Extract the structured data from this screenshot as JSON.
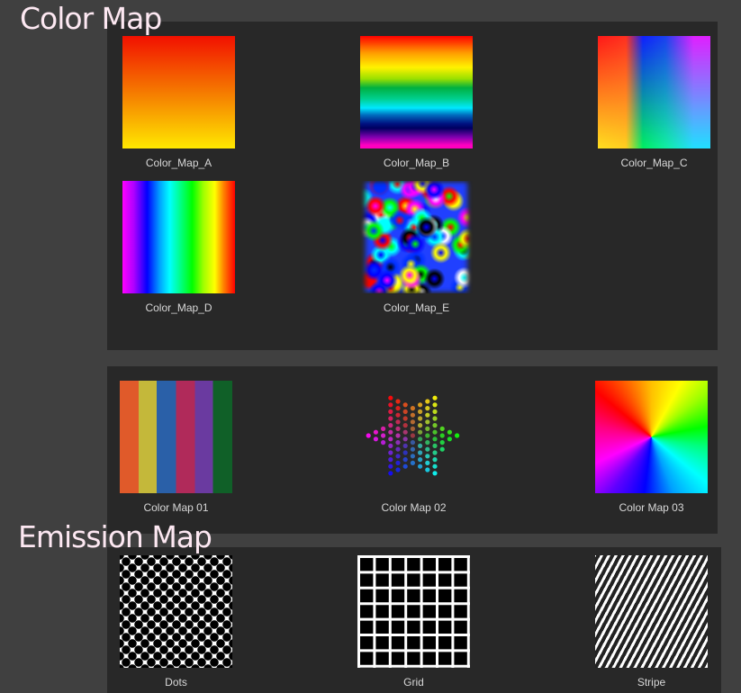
{
  "sections": [
    {
      "title": "Color Map"
    },
    {
      "title": "Emission Map"
    }
  ],
  "color_map_panel_1": {
    "items": [
      {
        "label": "Color_Map_A",
        "icon": "vertical-red-yellow-gradient"
      },
      {
        "label": "Color_Map_B",
        "icon": "horizontal-rainbow-bands"
      },
      {
        "label": "Color_Map_C",
        "icon": "2d-hue-gradient"
      },
      {
        "label": "Color_Map_D",
        "icon": "vertical-rainbow-bands"
      },
      {
        "label": "Color_Map_E",
        "icon": "color-noise"
      }
    ]
  },
  "color_map_panel_2": {
    "items": [
      {
        "label": "Color Map 01",
        "icon": "color-stripes"
      },
      {
        "label": "Color Map 02",
        "icon": "hexagram-dots"
      },
      {
        "label": "Color Map 03",
        "icon": "color-wheel-rays"
      }
    ]
  },
  "emission_map_panel": {
    "items": [
      {
        "label": "Dots",
        "icon": "dot-pattern"
      },
      {
        "label": "Grid",
        "icon": "grid-pattern"
      },
      {
        "label": "Stripe",
        "icon": "stripe-pattern"
      }
    ]
  }
}
